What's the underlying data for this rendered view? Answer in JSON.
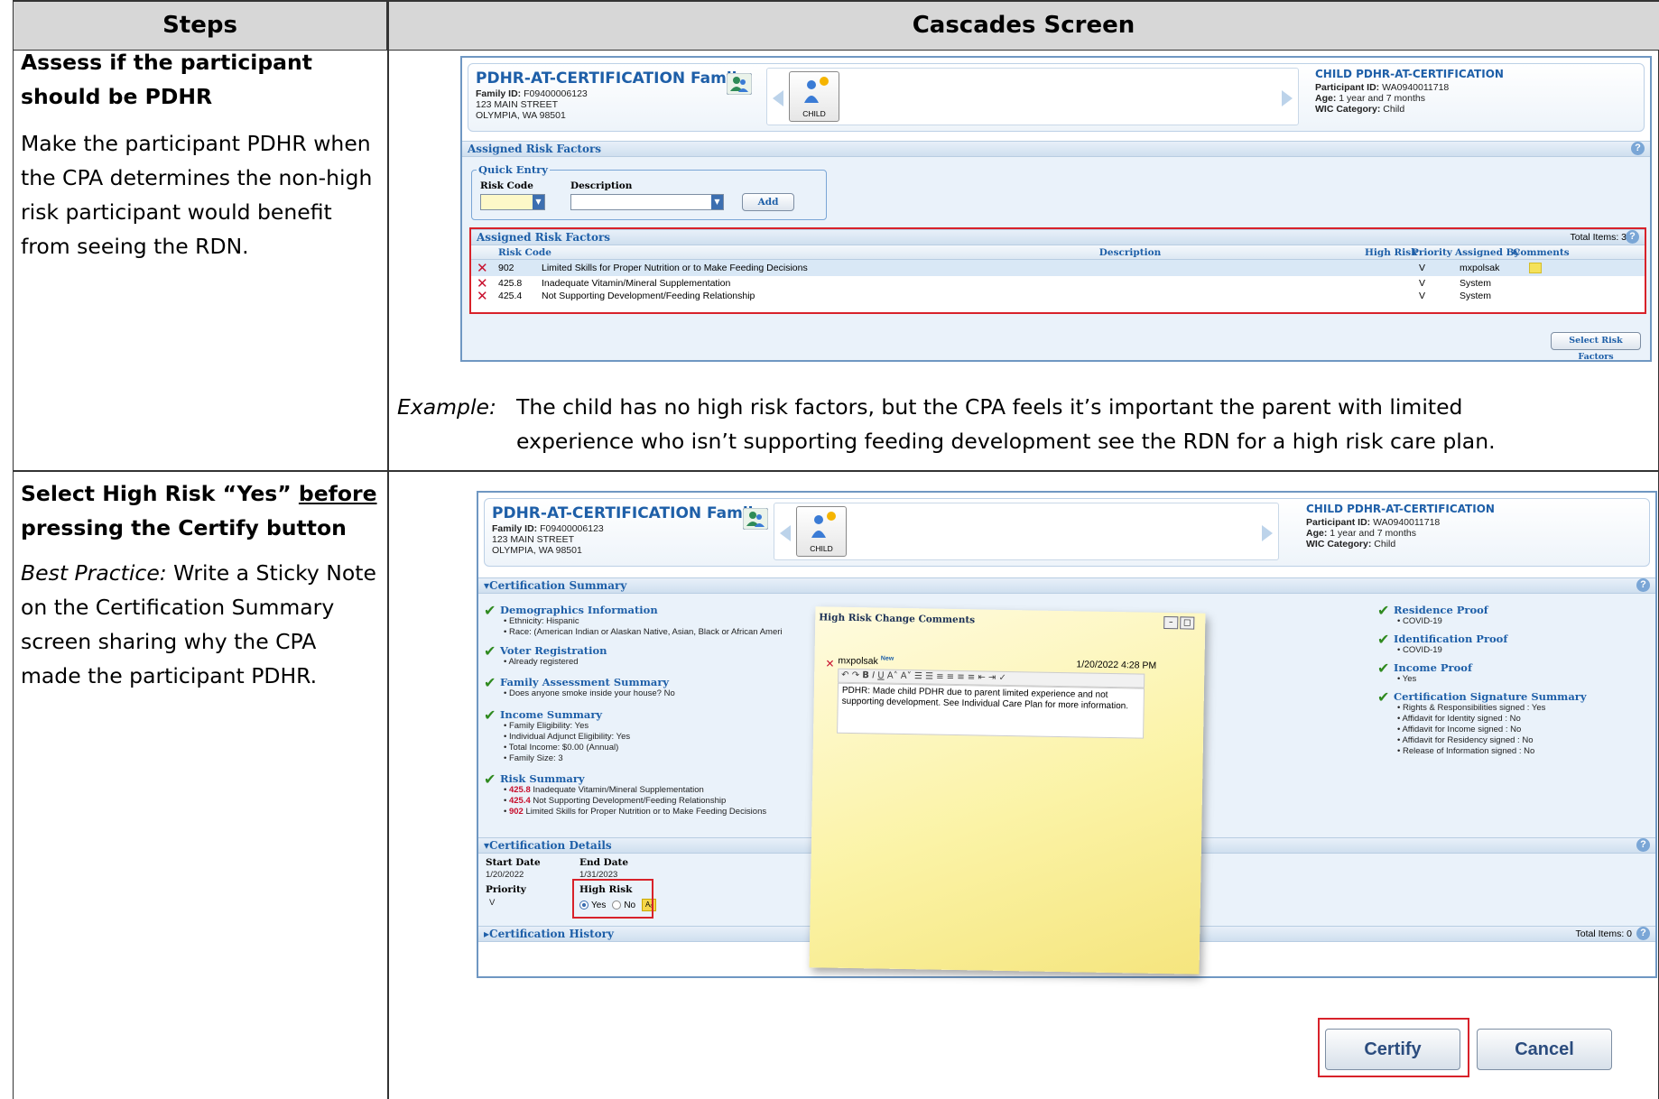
{
  "table": {
    "header_steps": "Steps",
    "header_screen": "Cascades Screen"
  },
  "row1": {
    "title": "Assess if the participant should be PDHR",
    "body": "Make the participant PDHR when the CPA determines the non-high risk participant would benefit from seeing the RDN.",
    "example_label": "Example:",
    "example_text_1": "The child has no high risk factors, but the CPA feels it’s important the parent with limited",
    "example_text_2": "experience who isn’t supporting feeding development see the RDN for a high risk care plan."
  },
  "row2": {
    "title_part1": "Select High Risk “Yes” ",
    "title_underlined": "before",
    "title_part2": "pressing the Certify button",
    "bp_label": "Best Practice:",
    "bp_text": " Write a Sticky Note on the Certification Summary screen sharing why the CPA made the participant PDHR."
  },
  "family": {
    "name": "PDHR-AT-CERTIFICATION Family",
    "id_label": "Family ID:",
    "id_value": "F09400006123",
    "street": "123 MAIN STREET",
    "city": "OLYMPIA,   WA   98501",
    "child_button": "CHILD",
    "participant_name": "CHILD PDHR-AT-CERTIFICATION",
    "pid_label": "Participant ID:",
    "pid_value": "WA0940011718",
    "age_label": "Age:",
    "age_value": "1 year and 7 months",
    "wic_label": "WIC Category:",
    "wic_value": "Child"
  },
  "risk_screen": {
    "section_title": "Assigned Risk Factors",
    "quick_entry": "Quick Entry",
    "risk_code_label": "Risk Code",
    "description_label": "Description",
    "add_button": "Add",
    "grid_title": "Assigned Risk Factors",
    "total_items": "Total Items: 3",
    "columns": [
      "Risk Code",
      "Description",
      "High Risk",
      "Priority",
      "Assigned By",
      "Comments"
    ],
    "rows": [
      {
        "code": "902",
        "desc": "Limited Skills for Proper Nutrition or to Make Feeding Decisions",
        "priority": "V",
        "by": "mxpolsak"
      },
      {
        "code": "425.8",
        "desc": "Inadequate Vitamin/Mineral Supplementation",
        "priority": "V",
        "by": "System"
      },
      {
        "code": "425.4",
        "desc": "Not Supporting Development/Feeding Relationship",
        "priority": "V",
        "by": "System"
      }
    ],
    "select_button": "Select Risk Factors"
  },
  "cert_screen": {
    "summary_title": "Certification Summary",
    "demographics": "Demographics Information",
    "ethnicity": "• Ethnicity: Hispanic",
    "race": "• Race: (American Indian or Alaskan Native, Asian, Black or African Ameri",
    "voter": "Voter Registration",
    "voter_1": "• Already registered",
    "fam_assess": "Family Assessment Summary",
    "fam_assess_1": "• Does anyone smoke inside your house? No",
    "income": "Income Summary",
    "income_1": "• Family Eligibility: Yes",
    "income_2": "• Individual Adjunct Eligibility: Yes",
    "income_3": "• Total Income: $0.00 (Annual)",
    "income_4": "• Family Size: 3",
    "risk_summary": "Risk Summary",
    "risk_items": [
      {
        "code": "425.8",
        "text": " Inadequate Vitamin/Mineral Supplementation"
      },
      {
        "code": "425.4",
        "text": " Not Supporting Development/Feeding Relationship"
      },
      {
        "code": "902",
        "text": " Limited Skills for Proper Nutrition or to Make Feeding Decisions"
      }
    ],
    "residence": "Residence Proof",
    "residence_1": "• COVID-19",
    "identification": "Identification Proof",
    "identification_1": "• COVID-19",
    "income_proof": "Income Proof",
    "income_proof_1": "• Yes",
    "signature": "Certification Signature Summary",
    "sig_items": [
      "• Rights & Responsibilities signed : Yes",
      "• Affidavit for Identity signed : No",
      "• Affidavit for Income signed : No",
      "• Affidavit for Residency signed : No",
      "• Release of Information signed : No"
    ],
    "details_title": "Certification Details",
    "start_date_label": "Start Date",
    "start_date": "1/20/2022",
    "end_date_label": "End Date",
    "end_date": "1/31/2023",
    "priority_label": "Priority",
    "priority_value": "V",
    "high_risk_label": "High Risk",
    "yes": "Yes",
    "no": "No",
    "history_title": "Certification History",
    "history_total": "Total Items: 0",
    "certify_button": "Certify",
    "cancel_button": "Cancel"
  },
  "sticky": {
    "title": "High Risk Change Comments",
    "user": "mxpolsak",
    "new_tag": "New",
    "timestamp": "1/20/2022 4:28 PM",
    "text": "PDHR: Made child PDHR due to parent limited experience and not supporting development. See Individual Care Plan for more information."
  },
  "colors": {
    "accent": "#1e5fa8",
    "highlight_box": "#d8222a",
    "sticky": "#fbf3a6"
  }
}
